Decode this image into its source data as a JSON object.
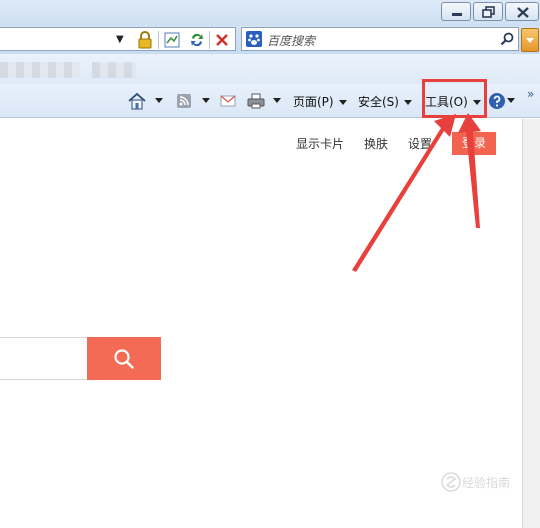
{
  "search": {
    "placeholder": "百度搜索"
  },
  "commandbar": {
    "page_menu": "页面(P)",
    "safety_menu": "安全(S)",
    "tools_menu": "工具(O)"
  },
  "page": {
    "links": [
      "显示卡片",
      "换肤",
      "设置"
    ],
    "login": "登录"
  },
  "annotation": {
    "color": "#e8403c"
  },
  "watermark": {
    "text": "经验指南"
  }
}
